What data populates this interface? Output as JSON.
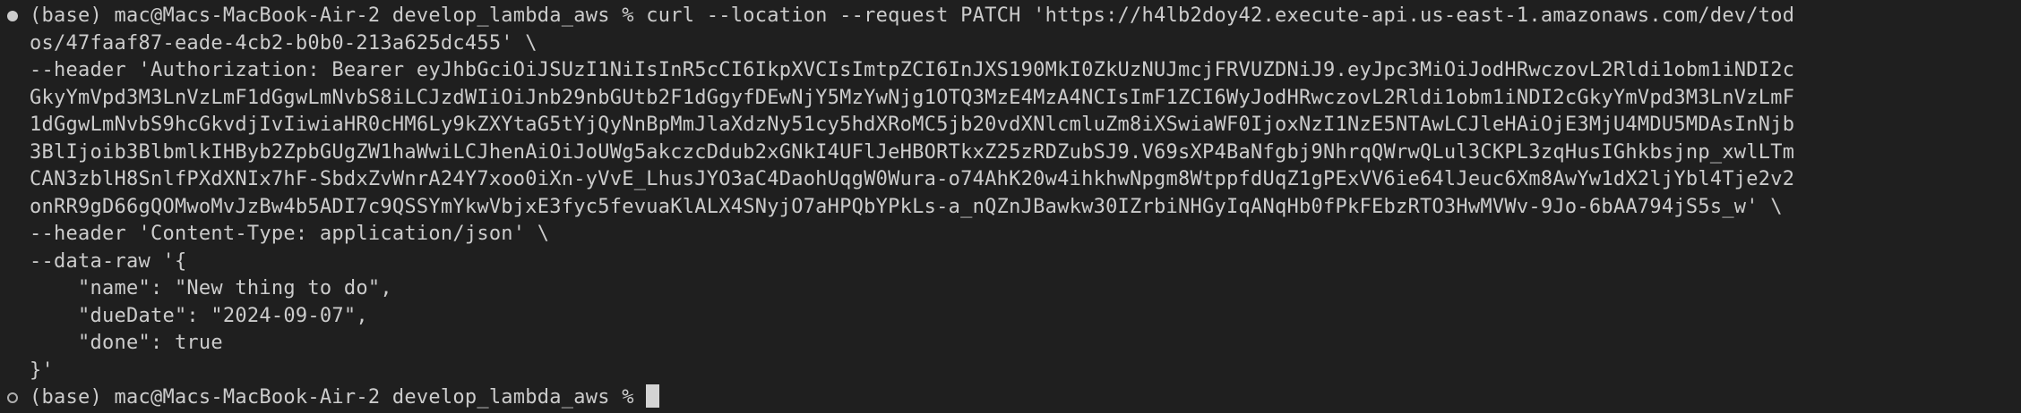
{
  "terminal": {
    "lines": [
      {
        "marker": "filled",
        "text": "(base) mac@Macs-MacBook-Air-2 develop_lambda_aws % curl --location --request PATCH 'https://h4lb2doy42.execute-api.us-east-1.amazonaws.com/dev/tod"
      },
      {
        "marker": "",
        "text": "os/47faaf87-eade-4cb2-b0b0-213a625dc455' \\"
      },
      {
        "marker": "",
        "text": "--header 'Authorization: Bearer eyJhbGciOiJSUzI1NiIsInR5cCI6IkpXVCIsImtpZCI6InJXS190MkI0ZkUzNUJmcjFRVUZDNiJ9.eyJpc3MiOiJodHRwczovL2Rldi1obm1iNDI2c"
      },
      {
        "marker": "",
        "text": "GkyYmVpd3M3LnVzLmF1dGgwLmNvbS8iLCJzdWIiOiJnb29nbGUtb2F1dGgyfDEwNjY5MzYwNjg1OTQ3MzE4MzA4NCIsImF1ZCI6WyJodHRwczovL2Rldi1obm1iNDI2cGkyYmVpd3M3LnVzLmF"
      },
      {
        "marker": "",
        "text": "1dGgwLmNvbS9hcGkvdjIvIiwiaHR0cHM6Ly9kZXYtaG5tYjQyNnBpMmJlaXdzNy51cy5hdXRoMC5jb20vdXNlcmluZm8iXSwiaWF0IjoxNzI1NzE5NTAwLCJleHAiOjE3MjU4MDU5MDAsInNjb"
      },
      {
        "marker": "",
        "text": "3BlIjoib3BlbmlkIHByb2ZpbGUgZW1haWwiLCJhenAiOiJoUWg5akczcDdub2xGNkI4UFlJeHBORTkxZ25zRDZubSJ9.V69sXP4BaNfgbj9NhrqQWrwQLul3CKPL3zqHusIGhkbsjnp_xwlLTm"
      },
      {
        "marker": "",
        "text": "CAN3zblH8SnlfPXdXNIx7hF-SbdxZvWnrA24Y7xoo0iXn-yVvE_LhusJYO3aC4DaohUqgW0Wura-o74AhK20w4ihkhwNpgm8WtppfdUqZ1gPExVV6ie64lJeuc6Xm8AwYw1dX2ljYbl4Tje2v2"
      },
      {
        "marker": "",
        "text": "onRR9gD66gQOMwoMvJzBw4b5ADI7c9QSSYmYkwVbjxE3fyc5fevuaKlALX4SNyjO7aHPQbYPkLs-a_nQZnJBawkw30IZrbiNHGyIqANqHb0fPkFEbzRTO3HwMVWv-9Jo-6bAA794jS5s_w' \\"
      },
      {
        "marker": "",
        "text": "--header 'Content-Type: application/json' \\"
      },
      {
        "marker": "",
        "text": "--data-raw '{"
      },
      {
        "marker": "",
        "text": "    \"name\": \"New thing to do\","
      },
      {
        "marker": "",
        "text": "    \"dueDate\": \"2024-09-07\","
      },
      {
        "marker": "",
        "text": "    \"done\": true"
      },
      {
        "marker": "",
        "text": "}'"
      },
      {
        "marker": "hollow",
        "text": "(base) mac@Macs-MacBook-Air-2 develop_lambda_aws % "
      }
    ]
  },
  "colors": {
    "background": "#1f1f1f",
    "foreground": "#cccccc",
    "cursor": "#d4d4d4"
  }
}
